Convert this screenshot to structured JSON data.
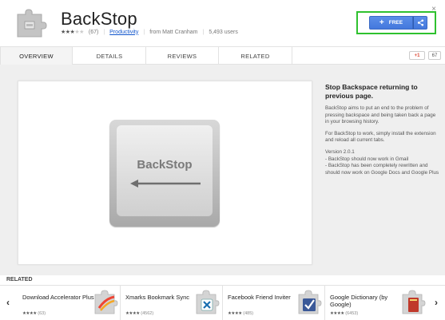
{
  "header": {
    "title": "BackStop",
    "rating_count": "(67)",
    "category": "Productivity",
    "author": "from Matt Cranham",
    "users": "5,493 users",
    "close": "×",
    "free_label": "FREE",
    "stars_filled": 3,
    "stars_total": 5
  },
  "tabs": [
    {
      "label": "OVERVIEW",
      "active": true
    },
    {
      "label": "DETAILS",
      "active": false
    },
    {
      "label": "REVIEWS",
      "active": false
    },
    {
      "label": "RELATED",
      "active": false
    }
  ],
  "social": {
    "gplus_label": "+1",
    "gplus_count": "67"
  },
  "screenshot": {
    "key_label": "BackStop"
  },
  "description": {
    "title": "Stop Backspace returning to previous page.",
    "p1": "BackStop aims to put an end to the problem of pressing backspace and being taken back a page in your browsing history.",
    "p2": "For BackStop to work, simply install the extension and reload all current tabs.",
    "p3_line1": "Version 2.0.1",
    "p3_line2": "- BackStop should now work in Gmail",
    "p3_line3": "- BackStop has been completely rewritten and should now work on Google Docs and Google Plus"
  },
  "related": {
    "label": "RELATED",
    "prev_arrow": "‹",
    "next_arrow": "›",
    "items": [
      {
        "name": "Download Accelerator Plus",
        "count": "(63)",
        "stars": 4,
        "icon": "dap-icon"
      },
      {
        "name": "Xmarks Bookmark Sync",
        "count": "(4562)",
        "stars": 4,
        "icon": "xmarks-icon"
      },
      {
        "name": "Facebook Friend Inviter",
        "count": "(485)",
        "stars": 4,
        "icon": "facebook-inviter-icon"
      },
      {
        "name": "Google Dictionary (by Google)",
        "count": "(6453)",
        "stars": 4,
        "icon": "google-dictionary-icon"
      }
    ]
  },
  "colors": {
    "accent_blue": "#4a7fe0",
    "highlight_green": "#2fc12f",
    "link_blue": "#1155cc"
  }
}
